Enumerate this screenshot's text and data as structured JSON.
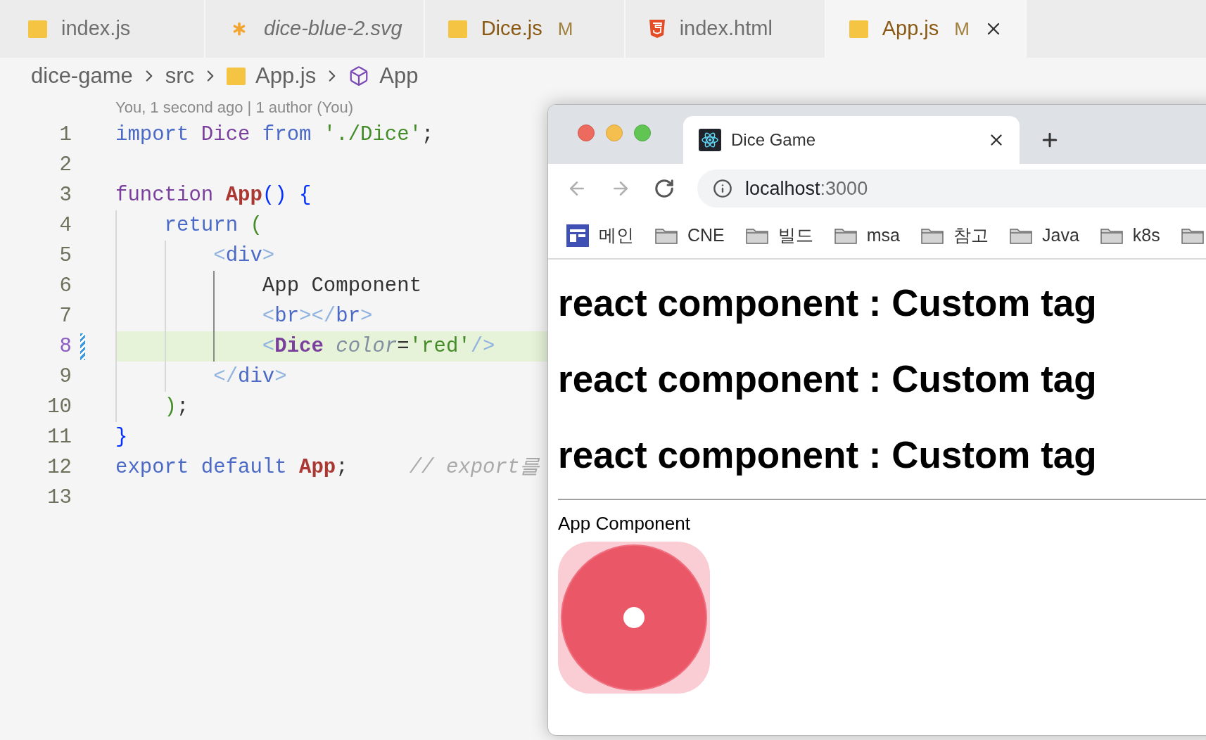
{
  "editor_tabs": [
    {
      "label": "index.js",
      "kind": "js",
      "preview": false,
      "modified": false,
      "selected": false
    },
    {
      "label": "dice-blue-2.svg",
      "kind": "svg",
      "preview": true,
      "modified": false,
      "selected": false
    },
    {
      "label": "Dice.js",
      "kind": "js",
      "preview": false,
      "modified": true,
      "badge": "M",
      "selected": false
    },
    {
      "label": "index.html",
      "kind": "html",
      "preview": false,
      "modified": false,
      "selected": false
    },
    {
      "label": "App.js",
      "kind": "js",
      "preview": false,
      "modified": true,
      "badge": "M",
      "selected": true
    }
  ],
  "breadcrumb": [
    {
      "label": "dice-game",
      "kind": "folder"
    },
    {
      "label": "src",
      "kind": "folder"
    },
    {
      "label": "App.js",
      "kind": "js"
    },
    {
      "label": "App",
      "kind": "component"
    }
  ],
  "blame": "You, 1 second ago | 1 author (You)",
  "code_lines": [
    {
      "number": "1",
      "highlighted": false,
      "modified": false,
      "tokens": [
        {
          "text": "import",
          "kind": "keyword"
        },
        {
          "text": " Dice",
          "kind": "type"
        },
        {
          "text": " from",
          "kind": "keyword"
        },
        {
          "text": " './Dice'",
          "kind": "string"
        },
        {
          "text": ";",
          "kind": "punct"
        }
      ]
    },
    {
      "number": "2",
      "highlighted": false,
      "modified": false
    },
    {
      "number": "3",
      "highlighted": false,
      "modified": false,
      "tokens": [
        {
          "text": "function",
          "kind": "storage"
        },
        {
          "text": " App",
          "kind": "fn"
        },
        {
          "text": "()",
          "kind": "brace"
        },
        {
          "text": " {",
          "kind": "brace"
        }
      ]
    },
    {
      "number": "4",
      "highlighted": false,
      "modified": false,
      "tokens": [
        {
          "text": "    return",
          "kind": "keyword"
        },
        {
          "text": " (",
          "kind": "paren"
        }
      ]
    },
    {
      "number": "5",
      "highlighted": false,
      "modified": false,
      "tokens": [
        {
          "text": "        <",
          "kind": "tagbr"
        },
        {
          "text": "div",
          "kind": "tag"
        },
        {
          "text": ">",
          "kind": "tagbr"
        }
      ]
    },
    {
      "number": "6",
      "highlighted": false,
      "modified": false,
      "tokens": [
        {
          "text": "            App Component",
          "kind": "text"
        }
      ]
    },
    {
      "number": "7",
      "highlighted": false,
      "modified": false,
      "tokens": [
        {
          "text": "            <",
          "kind": "tagbr"
        },
        {
          "text": "br",
          "kind": "tag"
        },
        {
          "text": "></",
          "kind": "tagbr"
        },
        {
          "text": "br",
          "kind": "tag"
        },
        {
          "text": ">",
          "kind": "tagbr"
        }
      ]
    },
    {
      "number": "8",
      "highlighted": true,
      "modified": true,
      "tokens": [
        {
          "text": "            <",
          "kind": "tagbr"
        },
        {
          "text": "Dice",
          "kind": "component"
        },
        {
          "text": " color",
          "kind": "attr"
        },
        {
          "text": "=",
          "kind": "punct"
        },
        {
          "text": "'red'",
          "kind": "string"
        },
        {
          "text": "/>",
          "kind": "tagbr"
        }
      ]
    },
    {
      "number": "9",
      "highlighted": false,
      "modified": false,
      "tokens": [
        {
          "text": "        </",
          "kind": "tagbr"
        },
        {
          "text": "div",
          "kind": "tag"
        },
        {
          "text": ">",
          "kind": "tagbr"
        }
      ]
    },
    {
      "number": "10",
      "highlighted": false,
      "modified": false,
      "tokens": [
        {
          "text": "    )",
          "kind": "paren"
        },
        {
          "text": ";",
          "kind": "punct"
        }
      ]
    },
    {
      "number": "11",
      "highlighted": false,
      "modified": false,
      "tokens": [
        {
          "text": "}",
          "kind": "brace"
        }
      ]
    },
    {
      "number": "12",
      "highlighted": false,
      "modified": false,
      "tokens": [
        {
          "text": "export",
          "kind": "keyword"
        },
        {
          "text": " default",
          "kind": "keyword"
        },
        {
          "text": " App",
          "kind": "fn"
        },
        {
          "text": ";",
          "kind": "punct"
        },
        {
          "text": "     // export를",
          "kind": "comment"
        }
      ]
    },
    {
      "number": "13",
      "highlighted": false,
      "modified": false
    }
  ],
  "browser": {
    "tab_title": "Dice Game",
    "url_host": "localhost",
    "url_port": ":3000",
    "bookmarks": [
      {
        "label": "메인",
        "kind": "app"
      },
      {
        "label": "CNE",
        "kind": "folder"
      },
      {
        "label": "빌드",
        "kind": "folder"
      },
      {
        "label": "msa",
        "kind": "folder"
      },
      {
        "label": "참고",
        "kind": "folder"
      },
      {
        "label": "Java",
        "kind": "folder"
      },
      {
        "label": "k8s",
        "kind": "folder"
      },
      {
        "kind": "folder"
      }
    ],
    "page": {
      "headings": [
        "react component : Custom tag",
        "react component : Custom tag",
        "react component : Custom tag"
      ],
      "text": "App Component"
    }
  }
}
